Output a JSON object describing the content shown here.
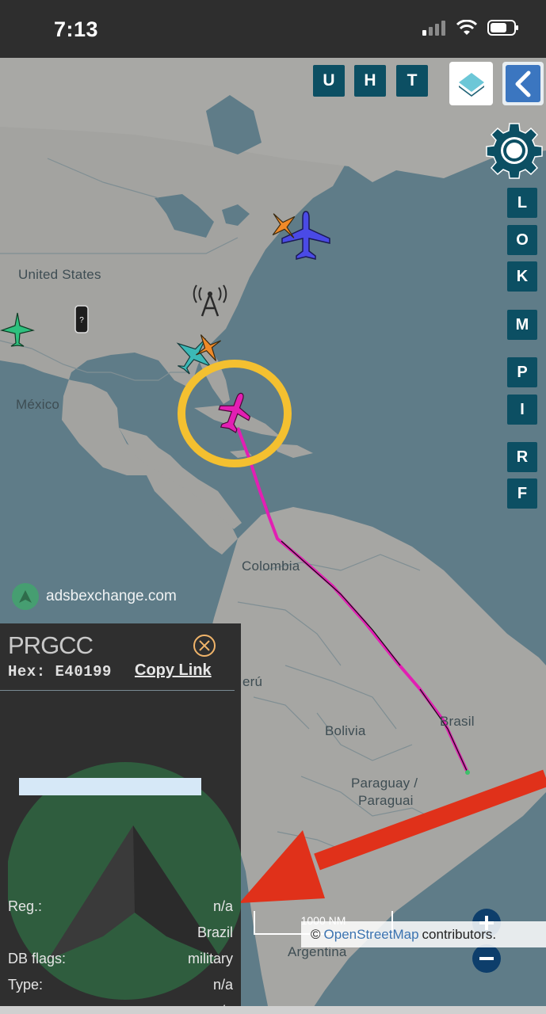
{
  "status": {
    "time": "7:13"
  },
  "map": {
    "labels": {
      "united_states": "United States",
      "mexico": "México",
      "colombia": "Colombia",
      "peru": "erú",
      "bolivia": "Bolivia",
      "brasil": "Brasil",
      "paraguay": "Paraguay /",
      "paraguai": "Paraguai",
      "argentina": "Argentina"
    },
    "brand": "adsbexchange.com",
    "scale": "1000 NM",
    "attribution": {
      "prefix": "©",
      "link": "OpenStreetMap",
      "suffix": "contributors."
    }
  },
  "top_buttons": [
    "U",
    "H",
    "T"
  ],
  "side_buttons": [
    "L",
    "O",
    "K",
    "M",
    "P",
    "I",
    "R",
    "F"
  ],
  "panel": {
    "callsign": "PRGCC",
    "hex_label": "Hex:",
    "hex": "E40199",
    "copy_link": "Copy Link",
    "rows": [
      {
        "key": "Reg.:",
        "value": "n/a"
      },
      {
        "key": "",
        "value": "Brazil"
      },
      {
        "key": "DB flags:",
        "value": "military"
      },
      {
        "key": "Type:",
        "value": "n/a"
      },
      {
        "key": "",
        "value": "n/a"
      }
    ]
  },
  "icons": {
    "signal": "cellular-signal-icon",
    "wifi": "wifi-icon",
    "battery": "battery-icon",
    "layers": "layers-icon",
    "back": "chevron-left-icon",
    "settings": "gear-icon",
    "close": "close-circle-icon",
    "zoom_in": "plus-icon",
    "zoom_out": "minus-icon",
    "tower": "radio-tower-icon",
    "unknown": "unknown-device-icon",
    "highlight": "highlight-ring-icon",
    "arrow": "red-arrow-icon"
  },
  "colors": {
    "button_bg": "#0c4f63",
    "track": "#e21fb3",
    "highlight": "#f4c030",
    "arrow": "#e0311a"
  }
}
